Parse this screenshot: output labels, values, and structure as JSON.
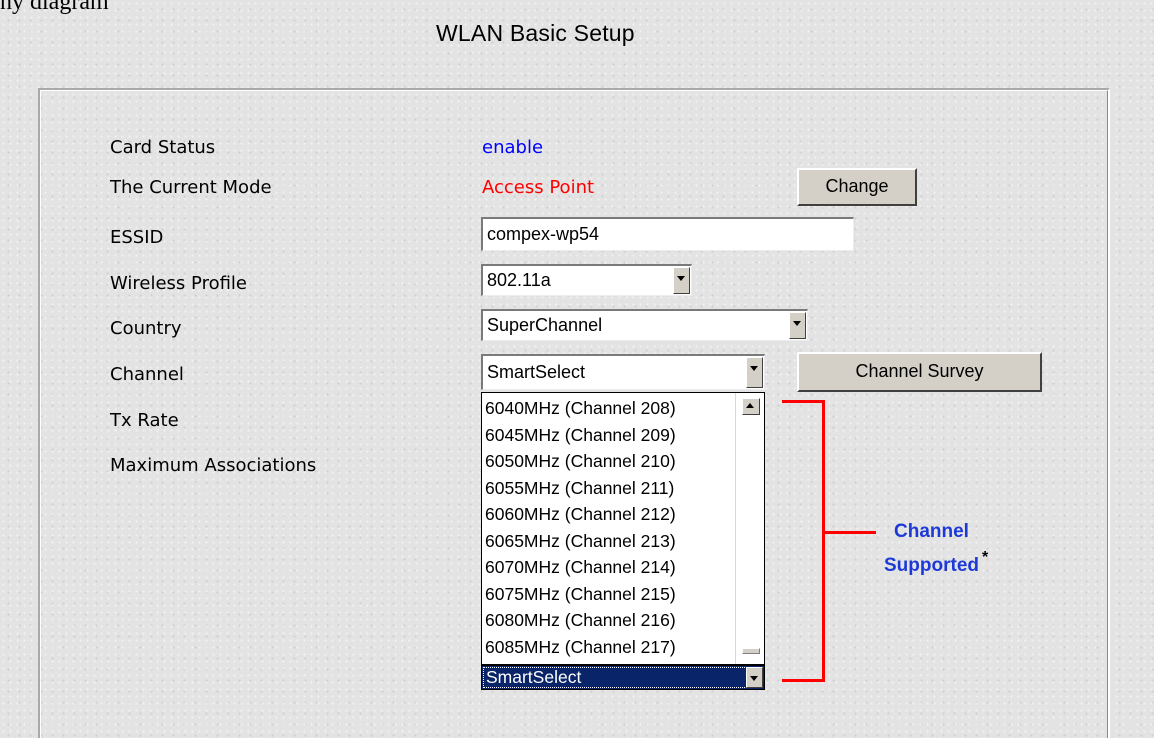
{
  "top_fragment": "ny diagram",
  "title": "WLAN Basic Setup",
  "form": {
    "card_status": {
      "label": "Card Status",
      "value": "enable",
      "color": "#0000ff"
    },
    "current_mode": {
      "label": "The Current Mode",
      "value": "Access Point",
      "color": "#ff0000",
      "button": "Change"
    },
    "essid": {
      "label": "ESSID",
      "value": "compex-wp54"
    },
    "wireless_profile": {
      "label": "Wireless Profile",
      "selected": "802.11a"
    },
    "country": {
      "label": "Country",
      "selected": "SuperChannel"
    },
    "channel": {
      "label": "Channel",
      "selected": "SmartSelect",
      "button": "Channel Survey"
    },
    "tx_rate": {
      "label": "Tx Rate"
    },
    "max_assoc": {
      "label": "Maximum Associations"
    }
  },
  "channel_list": [
    "6040MHz (Channel 208)",
    "6045MHz (Channel 209)",
    "6050MHz (Channel 210)",
    "6055MHz (Channel 211)",
    "6060MHz (Channel 212)",
    "6065MHz (Channel 213)",
    "6070MHz (Channel 214)",
    "6075MHz (Channel 215)",
    "6080MHz (Channel 216)",
    "6085MHz (Channel 217)"
  ],
  "channel_list_selected": "SmartSelect",
  "annotation": {
    "line1": "Channel",
    "line2": "Supported",
    "mark": "*",
    "color": "#1e3ad6",
    "bracket_color": "#ff0000"
  },
  "icons": {
    "dropdown": "chevron-down-icon",
    "scroll_up": "chevron-up-icon"
  }
}
